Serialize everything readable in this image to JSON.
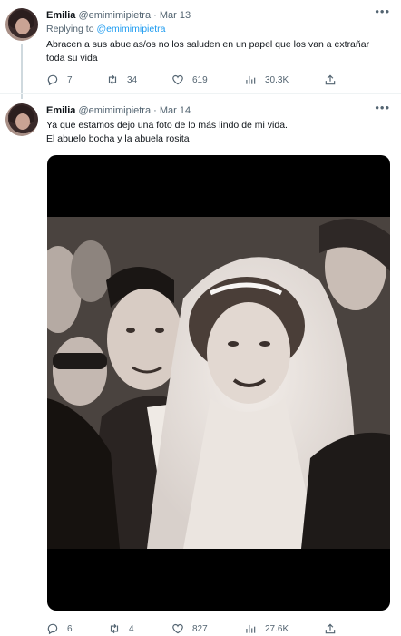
{
  "tweets": [
    {
      "user": {
        "name": "Emilia",
        "handle": "@emimimipietra"
      },
      "separator": "·",
      "date": "Mar 13",
      "replying": {
        "prefix": "Replying to",
        "to": "@emimimipietra"
      },
      "text": "Abracen a sus abuelas/os no los saluden en un papel que los van a extrañar toda su vida",
      "actions": {
        "replies": "7",
        "retweets": "34",
        "likes": "619",
        "views": "30.3K"
      }
    },
    {
      "user": {
        "name": "Emilia",
        "handle": "@emimimipietra"
      },
      "separator": "·",
      "date": "Mar 14",
      "text_lines": [
        "Ya que estamos dejo una foto de lo más lindo de mi vida.",
        "El abuelo bocha y la abuela rosita"
      ],
      "actions": {
        "replies": "6",
        "retweets": "4",
        "likes": "827",
        "views": "27.6K"
      }
    }
  ],
  "icons": {
    "more": "more-horizontal-icon",
    "reply": "reply-bubble-icon",
    "retweet": "retweet-arrows-icon",
    "like": "heart-icon",
    "views": "bar-chart-icon",
    "share": "share-upload-icon"
  },
  "colors": {
    "text": "#0f1419",
    "secondary": "#536471",
    "link": "#1d9bf0",
    "divider": "#eff3f4"
  }
}
